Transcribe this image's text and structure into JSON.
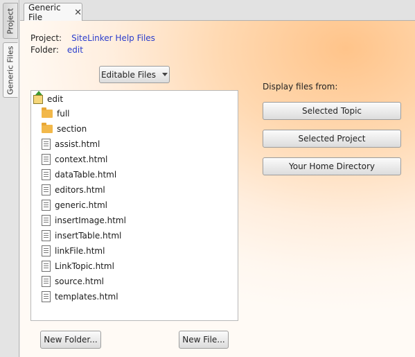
{
  "side_tabs": [
    {
      "label": "Project"
    },
    {
      "label": "Generic Files"
    }
  ],
  "editor_tab": {
    "title": "Generic File",
    "close_glyph": "✕"
  },
  "info": {
    "project_label": "Project:",
    "project_value": "SiteLinker Help Files",
    "folder_label": "Folder:",
    "folder_value": "edit"
  },
  "filter_dropdown": {
    "selected": "Editable Files"
  },
  "file_tree": {
    "root": {
      "name": "edit",
      "icon": "home-folder-icon"
    },
    "folders": [
      "full",
      "section"
    ],
    "files": [
      "assist.html",
      "context.html",
      "dataTable.html",
      "editors.html",
      "generic.html",
      "insertImage.html",
      "insertTable.html",
      "linkFile.html",
      "LinkTopic.html",
      "source.html",
      "templates.html"
    ]
  },
  "display_from": {
    "label": "Display files from:",
    "buttons": [
      "Selected Topic",
      "Selected Project",
      "Your Home Directory"
    ]
  },
  "actions": {
    "new_folder": "New Folder...",
    "new_file": "New File..."
  },
  "colors": {
    "link": "#2a3ccc",
    "panel_accent": "#ffc48a"
  }
}
